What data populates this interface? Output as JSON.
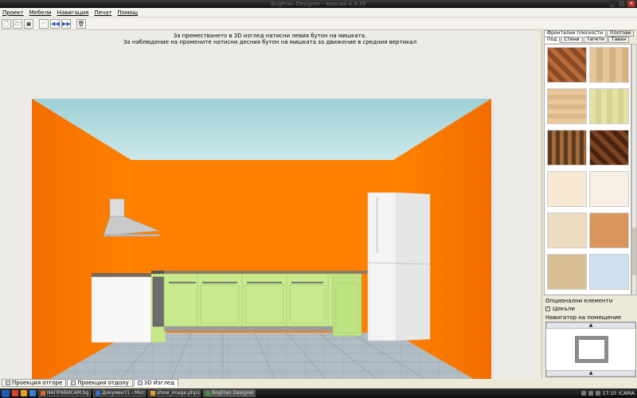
{
  "window": {
    "title": "BogFran Designer - версия 4.9.35"
  },
  "menu": [
    "Проект",
    "Мебели",
    "Навигация",
    "Печат",
    "Помощ"
  ],
  "toolbar": {
    "buttons": [
      {
        "name": "new-project-icon",
        "glyph": "🗋"
      },
      {
        "name": "open-project-icon",
        "glyph": "🗁"
      },
      {
        "name": "save-project-icon",
        "glyph": "▣"
      },
      {
        "name": "undo-icon",
        "glyph": "↶"
      },
      {
        "name": "rewind-icon",
        "glyph": "◀◀"
      },
      {
        "name": "forward-icon",
        "glyph": "▶▶"
      },
      {
        "name": "delete-icon",
        "glyph": "🗑"
      }
    ]
  },
  "viewport": {
    "hint_line1": "За преместването в 3D изглед натисни левия бутон на мишката.",
    "hint_line2": "За наблюдение на промените натисни десния бутон на мишката за движение в средния вертикал"
  },
  "view_tabs": [
    {
      "label": "Проекция отгоре",
      "active": false
    },
    {
      "label": "Проекция отдолу",
      "active": false
    },
    {
      "label": "3D Изглед",
      "active": true
    }
  ],
  "panel": {
    "top_tabs": [
      {
        "label": "Фронтални плоскости",
        "active": true
      },
      {
        "label": "Плотове",
        "active": false
      }
    ],
    "sub_tabs": [
      {
        "label": "Под",
        "active": true
      },
      {
        "label": "Стени",
        "active": false
      },
      {
        "label": "Тапети",
        "active": false
      },
      {
        "label": "Таван",
        "active": false
      }
    ],
    "optional_title": "Опционални елементи",
    "plinths_label": "Цокъли",
    "plinths_checked": true,
    "navigator_title": "Навигатор на помещение",
    "nav_up_glyph": "▲",
    "nav_down_glyph": "▲"
  },
  "colors": {
    "wall": "#ff7b00",
    "ceiling": "#b3dbe0",
    "floor": "#a9b2ba",
    "cabinet_green": "#c6ea8c",
    "fridge": "#f2f2f2"
  },
  "taskbar": {
    "tasks": [
      {
        "label": "НАПРАВИСАМ.bg",
        "active": false
      },
      {
        "label": "Документ1 - Micro",
        "active": false
      },
      {
        "label": "show_image.php1 j",
        "active": false
      },
      {
        "label": "BogFran Designer -",
        "active": true
      }
    ],
    "clock": "17:10",
    "tray_text": "ICARIA"
  }
}
